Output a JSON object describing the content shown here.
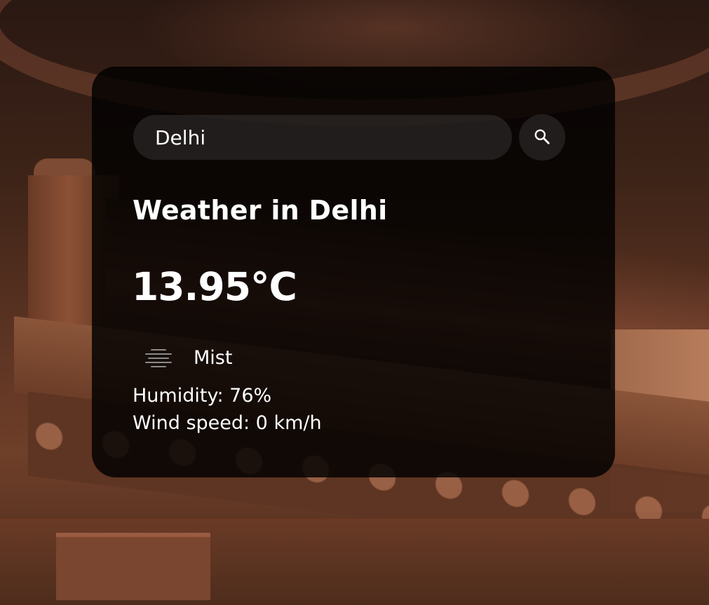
{
  "search": {
    "value": "Delhi",
    "placeholder": "Search"
  },
  "weather": {
    "title": "Weather in Delhi",
    "temperature": "13.95°C",
    "icon": "mist-icon",
    "description": "Mist",
    "humidity": "Humidity: 76%",
    "wind": "Wind speed: 0 km/h"
  },
  "colors": {
    "card_background": "#000000",
    "text": "#ffffff",
    "background_tone": "#5b3322"
  }
}
